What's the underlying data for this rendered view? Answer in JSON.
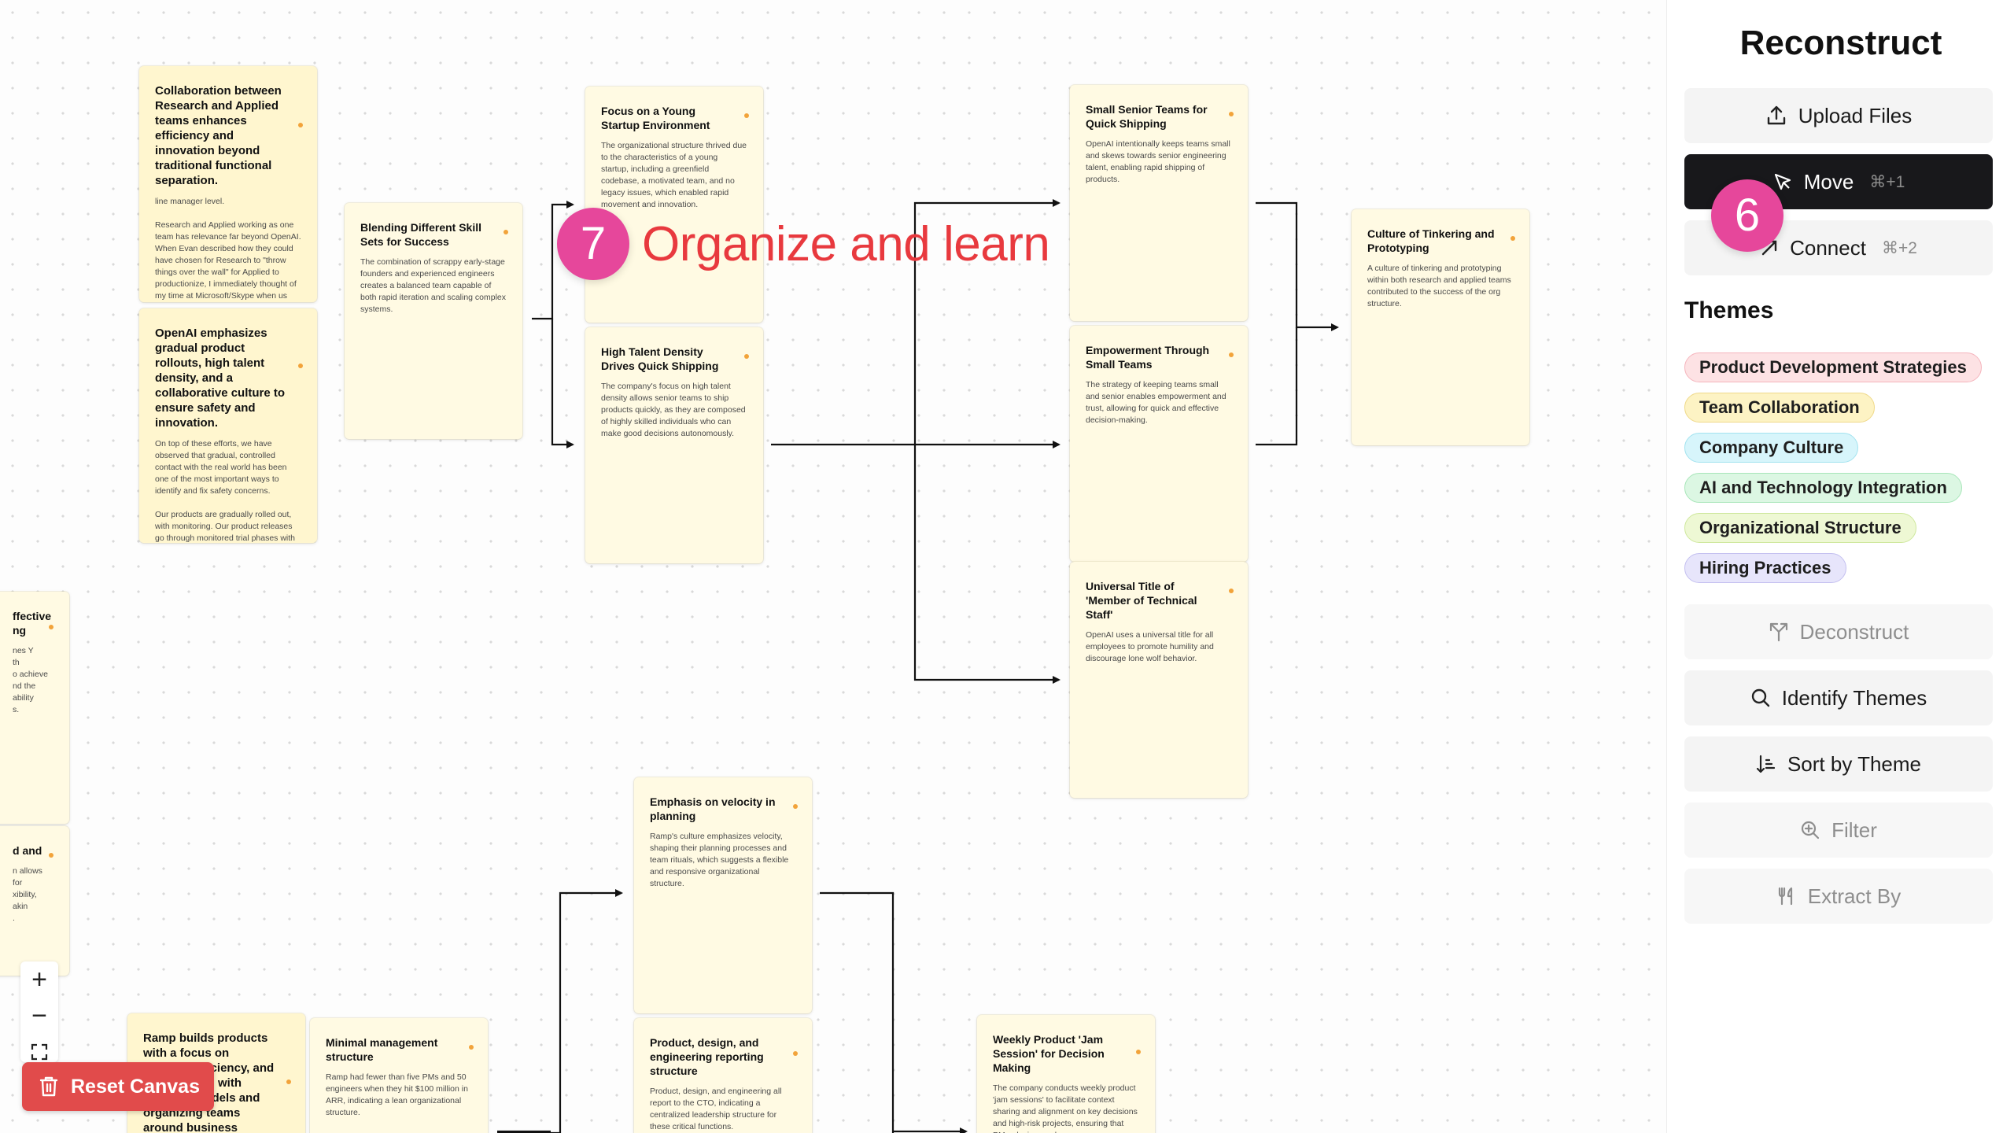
{
  "app": {
    "title": "Reconstruct"
  },
  "toolbar": {
    "upload": {
      "label": "Upload Files",
      "icon": "upload-icon"
    },
    "move": {
      "label": "Move",
      "shortcut": "⌘+1",
      "icon": "cursor-icon"
    },
    "connect": {
      "label": "Connect",
      "shortcut": "⌘+2",
      "icon": "arrow-icon"
    }
  },
  "themes": {
    "heading": "Themes",
    "items": [
      {
        "label": "Product Development Strategies",
        "bg": "#fde2e4",
        "border": "#f5b5bd"
      },
      {
        "label": "Team Collaboration",
        "bg": "#fdf3c4",
        "border": "#efd98a"
      },
      {
        "label": "Company Culture",
        "bg": "#d7f5fb",
        "border": "#a3e3ef"
      },
      {
        "label": "AI and Technology Integration",
        "bg": "#dcf7e3",
        "border": "#a9e6ba"
      },
      {
        "label": "Organizational Structure",
        "bg": "#eef8d4",
        "border": "#cfe89e"
      },
      {
        "label": "Hiring Practices",
        "bg": "#e7e5fb",
        "border": "#c4c0f0"
      }
    ]
  },
  "actions": {
    "deconstruct": {
      "label": "Deconstruct",
      "icon": "split-icon"
    },
    "identify_themes": {
      "label": "Identify Themes",
      "icon": "search-icon"
    },
    "sort_by_theme": {
      "label": "Sort by Theme",
      "icon": "sort-icon"
    },
    "filter": {
      "label": "Filter",
      "icon": "zoom-in-icon"
    },
    "extract_by": {
      "label": "Extract By",
      "icon": "utensils-icon"
    }
  },
  "annotations": {
    "step6": "6",
    "step7": "7",
    "step7_text": "Organize and learn"
  },
  "canvas_controls": {
    "zoom_in": "+",
    "zoom_out": "−",
    "reset_label": "Reset Canvas"
  },
  "cards": {
    "collab": {
      "title": "Collaboration between Research and Applied teams enhances efficiency and innovation beyond traditional functional separation.",
      "body": "line manager level.\n\nResearch and Applied working as one team has relevance far beyond OpenAI. When Evan described how they could have chosen for Research to \"throw things over the wall\" for Applied to productionize, I immediately thought of my time at Microsoft/Skype when us devs \"threw things over the wall\" to QA to"
    },
    "gradual": {
      "title": "OpenAI emphasizes gradual product rollouts, high talent density, and a collaborative culture to ensure safety and innovation.",
      "body": "On top of these efforts, we have observed that gradual, controlled contact with the real world has been one of the most important ways to identify and fix safety concerns.\n\nOur products are gradually rolled out, with monitoring. Our product releases go through monitored trial phases with select API customers and have incremental rollouts."
    },
    "blending": {
      "title": "Blending Different Skill Sets for Success",
      "body": "The combination of scrappy early-stage founders and experienced engineers creates a balanced team capable of both rapid iteration and scaling complex systems."
    },
    "young_startup": {
      "title": "Focus on a Young Startup Environment",
      "body": "The organizational structure thrived due to the characteristics of a young startup, including a greenfield codebase, a motivated team, and no legacy issues, which enabled rapid movement and innovation."
    },
    "talent_density": {
      "title": "High Talent Density Drives Quick Shipping",
      "body": "The company's focus on high talent density allows senior teams to ship products quickly, as they are composed of highly skilled individuals who can make good decisions autonomously."
    },
    "small_senior": {
      "title": "Small Senior Teams for Quick Shipping",
      "body": "OpenAI intentionally keeps teams small and skews towards senior engineering talent, enabling rapid shipping of products."
    },
    "empowerment": {
      "title": "Empowerment Through Small Teams",
      "body": "The strategy of keeping teams small and senior enables empowerment and trust, allowing for quick and effective decision-making."
    },
    "universal_title": {
      "title": "Universal Title of 'Member of Technical Staff'",
      "body": "OpenAI uses a universal title for all employees to promote humility and discourage lone wolf behavior."
    },
    "tinkering": {
      "title": "Culture of Tinkering and Prototyping",
      "body": "A culture of tinkering and prototyping within both research and applied teams contributed to the success of the org structure."
    },
    "velocity": {
      "title": "Emphasis on velocity in planning",
      "body": "Ramp's culture emphasizes velocity, shaping their planning processes and team rituals, which suggests a flexible and responsive organizational structure."
    },
    "pde": {
      "title": "Product, design, and engineering reporting structure",
      "body": "Product, design, and engineering all report to the CTO, indicating a centralized leadership structure for these critical functions."
    },
    "minimal_mgmt": {
      "title": "Minimal management structure",
      "body": "Ramp had fewer than five PMs and 50 engineers when they hit $100 million in ARR, indicating a lean organizational structure."
    },
    "ramp_builds": {
      "title": "Ramp builds products with a focus on velocity, efficiency, and ... aligning ... with financial models and organizing teams around business",
      "body": ""
    },
    "jam_session": {
      "title": "Weekly Product 'Jam Session' for Decision Making",
      "body": "The company conducts weekly product 'jam sessions' to facilitate context sharing and alignment on key decisions and high-risk projects, ensuring that PMs, design, and"
    },
    "left_partial_1": {
      "title": "ffective\nng",
      "body": "nes Y\nth\no achieve\nnd the ability\ns."
    },
    "left_partial_2": {
      "title": "d and",
      "body": "n allows for\nxibility, akin\n."
    }
  }
}
